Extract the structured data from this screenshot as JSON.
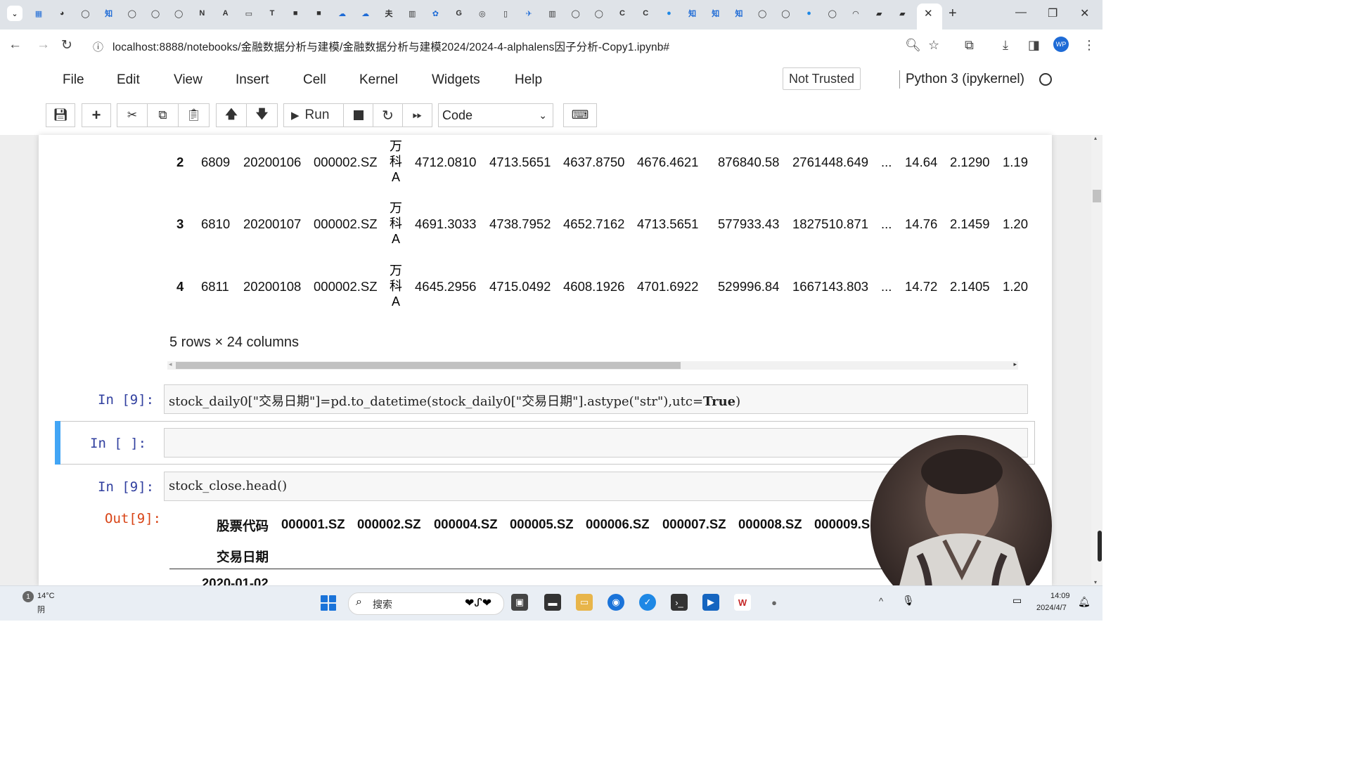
{
  "browser": {
    "url": "localhost:8888/notebooks/金融数据分析与建模/金融数据分析与建模2024/2024-4-alphalens因子分析-Copy1.ipynb#",
    "tab_icons": [
      "calendar-icon",
      "bilibili-icon",
      "github-icon",
      "zhihu-icon",
      "github-icon",
      "github-icon",
      "github-icon",
      "notion-icon",
      "a-icon",
      "video-icon",
      "tdx-icon",
      "book-icon",
      "book-icon",
      "cloud-icon",
      "cloud-icon",
      "kanji-icon",
      "reader-icon",
      "paw-icon",
      "google-icon",
      "globe-icon",
      "doc-icon",
      "bird-icon",
      "reader-icon",
      "github-icon",
      "github-icon",
      "c-icon",
      "c-icon",
      "circle-icon",
      "zhihu-icon",
      "zhihu-icon",
      "zhihu-icon",
      "github-icon",
      "github-icon",
      "circle-icon",
      "github-icon",
      "loading-icon",
      "tablet-icon",
      "tablet-icon"
    ],
    "tab_close": "✕",
    "new_tab": "+",
    "profile_label": "WP"
  },
  "menubar": {
    "items": [
      "File",
      "Edit",
      "View",
      "Insert",
      "Cell",
      "Kernel",
      "Widgets",
      "Help"
    ],
    "not_trusted": "Not Trusted",
    "kernel": "Python 3 (ipykernel)"
  },
  "toolbar": {
    "run_label": "Run",
    "cell_type": "Code"
  },
  "dataframe": {
    "rows": [
      {
        "idx": "2",
        "c1": "6809",
        "c2": "20200106",
        "c3": "000002.SZ",
        "name": [
          "万",
          "科",
          "A"
        ],
        "c5": "4712.0810",
        "c6": "4713.5651",
        "c7": "4637.8750",
        "c8": "4676.4621",
        "c9": "876840.58",
        "c10": "2761448.649",
        "ellipsis": "...",
        "c11": "14.64",
        "c12": "2.1290",
        "c13": "1.19"
      },
      {
        "idx": "3",
        "c1": "6810",
        "c2": "20200107",
        "c3": "000002.SZ",
        "name": [
          "万",
          "科",
          "A"
        ],
        "c5": "4691.3033",
        "c6": "4738.7952",
        "c7": "4652.7162",
        "c8": "4713.5651",
        "c9": "577933.43",
        "c10": "1827510.871",
        "ellipsis": "...",
        "c11": "14.76",
        "c12": "2.1459",
        "c13": "1.20"
      },
      {
        "idx": "4",
        "c1": "6811",
        "c2": "20200108",
        "c3": "000002.SZ",
        "name": [
          "万",
          "科",
          "A"
        ],
        "c5": "4645.2956",
        "c6": "4715.0492",
        "c7": "4608.1926",
        "c8": "4701.6922",
        "c9": "529996.84",
        "c10": "1667143.803",
        "ellipsis": "...",
        "c11": "14.72",
        "c12": "2.1405",
        "c13": "1.20"
      }
    ],
    "shape_info": "5 rows × 24 columns"
  },
  "cells": {
    "cell1_prompt": "In  [9]:",
    "cell1_code_a": "stock_daily0[\"交易日期\"]=pd.to_datetime(stock_daily0[\"交易日期\"].astype(\"str\"),utc=",
    "cell1_code_kw": "True",
    "cell1_code_b": ")",
    "cell2_prompt": "In  [ ]:",
    "cell3_prompt": "In  [9]:",
    "cell3_code": "stock_close.head()",
    "out3_prompt": "Out[9]:",
    "out_header_label": "股票代码",
    "out_index_label": "交易日期",
    "out_columns": [
      "000001.SZ",
      "000002.SZ",
      "000004.SZ",
      "000005.SZ",
      "000006.SZ",
      "000007.SZ",
      "000008.SZ",
      "000009.S"
    ],
    "out_first_date": "2020-01-02"
  },
  "taskbar": {
    "weather_badge": "1",
    "temperature": "14°C",
    "condition": "阴",
    "search_placeholder": "搜索",
    "time": "14:09",
    "date": "2024/4/7"
  }
}
